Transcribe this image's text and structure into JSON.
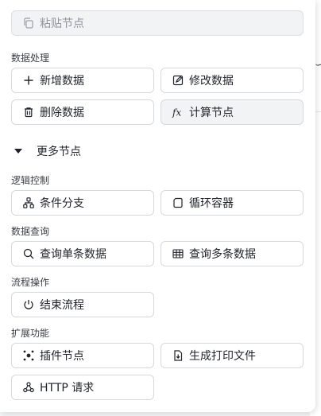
{
  "paste": {
    "label": "粘贴节点",
    "icon": "copy-icon"
  },
  "sections": {
    "data_processing": "数据处理",
    "logic_control": "逻辑控制",
    "data_query": "数据查询",
    "flow_operation": "流程操作",
    "extensions": "扩展功能"
  },
  "more_nodes": {
    "label": "更多节点",
    "icon": "caret-down-icon"
  },
  "buttons": {
    "add_data": {
      "label": "新增数据",
      "icon": "plus-icon"
    },
    "modify_data": {
      "label": "修改数据",
      "icon": "edit-icon"
    },
    "delete_data": {
      "label": "删除数据",
      "icon": "trash-icon"
    },
    "compute_node": {
      "label": "计算节点",
      "icon": "function-icon"
    },
    "branch": {
      "label": "条件分支",
      "icon": "branch-icon"
    },
    "loop": {
      "label": "循环容器",
      "icon": "container-icon"
    },
    "query_single": {
      "label": "查询单条数据",
      "icon": "search-icon"
    },
    "query_multi": {
      "label": "查询多条数据",
      "icon": "table-icon"
    },
    "end_flow": {
      "label": "结束流程",
      "icon": "power-icon"
    },
    "plugin_node": {
      "label": "插件节点",
      "icon": "plugin-icon"
    },
    "print_file": {
      "label": "生成打印文件",
      "icon": "file-download-icon"
    },
    "http_request": {
      "label": "HTTP 请求",
      "icon": "webhook-icon"
    }
  },
  "colors": {
    "border": "#d5d8dd",
    "active_bg": "#f2f3f5",
    "text": "#1f2329",
    "muted": "#8f959e"
  }
}
